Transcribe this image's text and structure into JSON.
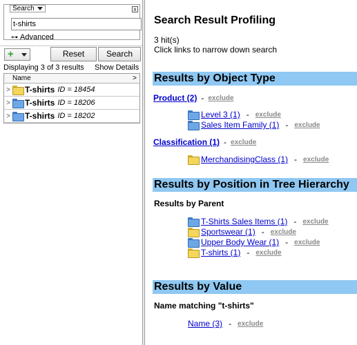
{
  "search": {
    "legend": "Search",
    "close": "x",
    "query": "t-shirts",
    "advanced": "Advanced"
  },
  "toolbar": {
    "add": "+",
    "reset": "Reset",
    "search": "Search"
  },
  "results_info": {
    "displaying": "Displaying 3 of 3 results",
    "show_details": "Show Details"
  },
  "tree": {
    "column": "Name",
    "rows": [
      {
        "name": "T-shirts",
        "id": "ID = 18454",
        "folder": "yellow"
      },
      {
        "name": "T-shirts",
        "id": "ID = 18206",
        "folder": "blue"
      },
      {
        "name": "T-shirts",
        "id": "ID = 18202",
        "folder": "blue"
      }
    ]
  },
  "profiling": {
    "title": "Search Result Profiling",
    "hits": "3 hit(s)",
    "narrow": "Click links to narrow down search",
    "sep": "-",
    "exclude": "exclude",
    "by_type": {
      "heading": "Results by Object Type",
      "groups": [
        {
          "label": "Product (2)",
          "items": [
            {
              "label": "Level 3 (1)",
              "folder": "blue"
            },
            {
              "label": "Sales Item Family (1)",
              "folder": "blue"
            }
          ]
        },
        {
          "label": "Classification (1)",
          "items": [
            {
              "label": "MerchandisingClass (1)",
              "folder": "yellow"
            }
          ]
        }
      ]
    },
    "by_position": {
      "heading": "Results by Position in Tree Hierarchy",
      "subheading": "Results by Parent",
      "items": [
        {
          "label": "T-Shirts Sales Items (1)",
          "folder": "blue"
        },
        {
          "label": "Sportswear (1)",
          "folder": "yellow"
        },
        {
          "label": "Upper Body Wear (1)",
          "folder": "blue"
        },
        {
          "label": "T-shirts (1)",
          "folder": "yellow"
        }
      ]
    },
    "by_value": {
      "heading": "Results by Value",
      "subheading": "Name matching \"t-shirts\"",
      "items": [
        {
          "label": "Name (3)"
        }
      ]
    }
  },
  "colors": {
    "section_bg": "#8fc8f2",
    "link": "#0000cc",
    "folder_yellow": "#f3d65c",
    "folder_blue": "#6ea7e6"
  }
}
